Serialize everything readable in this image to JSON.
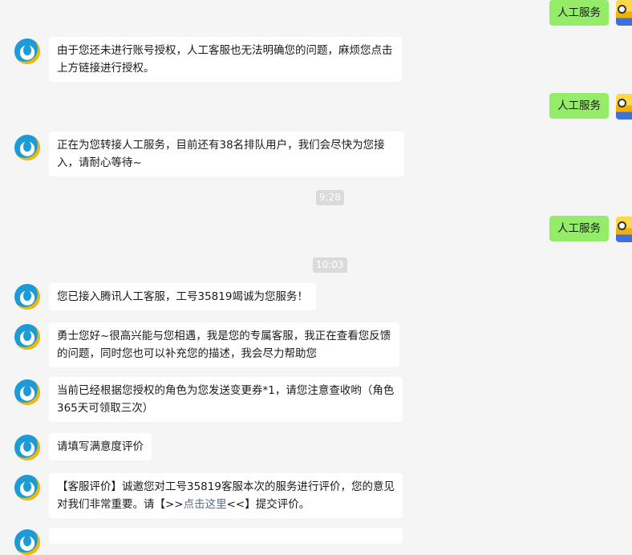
{
  "messages": {
    "user_1": "人工服务",
    "bot_1": "由于您还未进行账号授权，人工客服也无法明确您的问题，麻烦您点击上方链接进行授权。",
    "user_2": "人工服务",
    "bot_2": "正在为您转接人工服务，目前还有38名排队用户，我们会尽快为您接入，请耐心等待~",
    "time_1": "9:28",
    "user_3": "人工服务",
    "time_2": "10:03",
    "bot_3": "您已接入腾讯人工客服，工号35819竭诚为您服务！",
    "bot_4": "勇士您好~很高兴能与您相遇，我是您的专属客服，我正在查看您反馈的问题，同时您也可以补充您的描述，我会尽力帮助您",
    "bot_5": "当前已经根据您授权的角色为您发送变更券*1，请您注意查收哟（角色365天可领取三次）",
    "bot_6": "请填写满意度评价",
    "bot_7_prefix": "【客服评价】诚邀您对工号35819客服本次的服务进行评价，您的意见对我们非常重要。请【>>",
    "bot_7_link": "点击这里",
    "bot_7_suffix": "<<】提交评价。"
  }
}
